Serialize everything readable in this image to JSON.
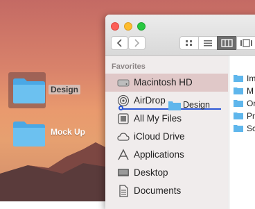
{
  "desktop": {
    "items": [
      {
        "label": "Design",
        "selected": true
      },
      {
        "label": "Mock Up",
        "selected": false
      }
    ]
  },
  "finder": {
    "sidebar": {
      "heading": "Favorites",
      "items": [
        {
          "label": "Macintosh HD",
          "icon": "hard-drive-icon",
          "active": true
        },
        {
          "label": "AirDrop",
          "icon": "airdrop-icon",
          "active": false
        },
        {
          "label": "All My Files",
          "icon": "all-files-icon",
          "active": false
        },
        {
          "label": "iCloud Drive",
          "icon": "cloud-icon",
          "active": false
        },
        {
          "label": "Applications",
          "icon": "applications-icon",
          "active": false
        },
        {
          "label": "Desktop",
          "icon": "desktop-icon",
          "active": false
        },
        {
          "label": "Documents",
          "icon": "documents-icon",
          "active": false
        }
      ]
    },
    "column_items": [
      "Im",
      "M",
      "Or",
      "Pr",
      "Sc"
    ],
    "drag_item": {
      "label": "Design"
    }
  },
  "colors": {
    "folder": "#5fb6ec",
    "drop_indicator": "#2c57d6",
    "selected_row": "#e0c8c8"
  }
}
